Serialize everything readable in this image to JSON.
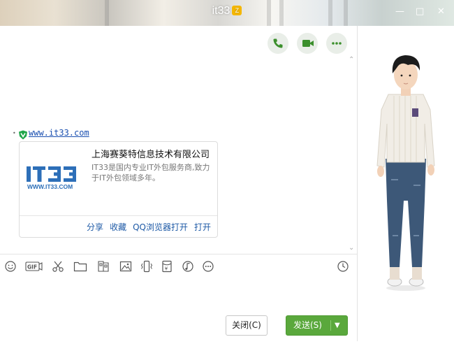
{
  "window": {
    "title": "it33",
    "badge": "Z"
  },
  "header_actions": [
    "voice-call",
    "video-call",
    "more"
  ],
  "message": {
    "link_text": "www.it33.com",
    "card": {
      "title": "上海赛葵特信息技术有限公司",
      "description": "IT33是国内专业IT外包服务商,致力于IT外包领域多年。",
      "logo_main": "IT33",
      "logo_sub": "WWW.IT33.COM",
      "actions": {
        "share": "分享",
        "favorite": "收藏",
        "open_qq_browser": "QQ浏览器打开",
        "open": "打开"
      }
    }
  },
  "toolbar_icons": [
    "emoji-icon",
    "gif-icon",
    "scissors-icon",
    "folder-icon",
    "image-grid-icon",
    "picture-icon",
    "vibrate-icon",
    "red-packet-icon",
    "music-icon",
    "more-icon",
    "history-clock-icon"
  ],
  "footer": {
    "close_label": "关闭(C)",
    "send_label": "发送(S)"
  },
  "colors": {
    "accent": "#5aa83c",
    "link": "#1e5aa6"
  }
}
